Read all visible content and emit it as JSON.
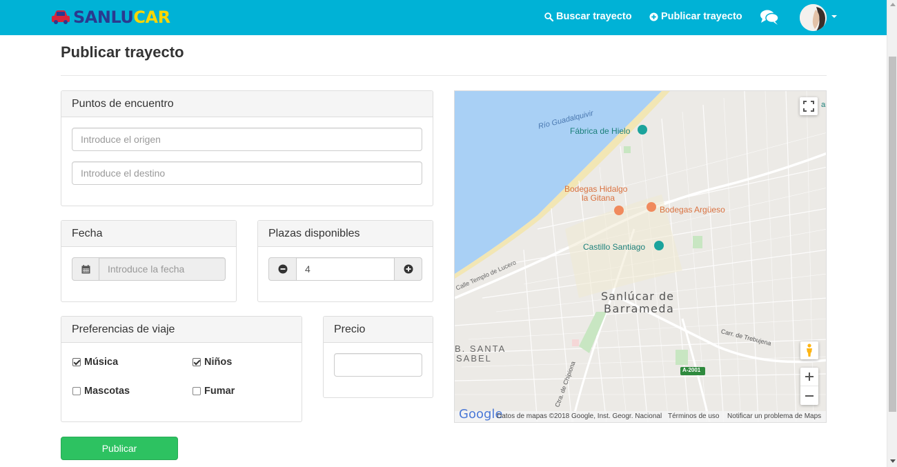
{
  "brand": {
    "part1": "SANLU",
    "part2": "CAR",
    "colors": {
      "navy": "#2a3a8f",
      "yellow": "#ffd600",
      "red": "#d8243a"
    }
  },
  "nav": {
    "search_label": "Buscar trayecto",
    "publish_label": "Publicar trayecto",
    "icons": [
      "search-icon",
      "plus-circle-icon",
      "chat-icon",
      "avatar",
      "caret-down-icon"
    ],
    "background": "#00b2d6"
  },
  "page": {
    "title": "Publicar trayecto"
  },
  "meeting_points": {
    "heading": "Puntos de encuentro",
    "origin": {
      "value": "",
      "placeholder": "Introduce el origen"
    },
    "destination": {
      "value": "",
      "placeholder": "Introduce el destino"
    }
  },
  "date": {
    "heading": "Fecha",
    "value": "",
    "placeholder": "Introduce la fecha",
    "icon": "calendar-icon"
  },
  "seats": {
    "heading": "Plazas disponibles",
    "value": "4",
    "icons": [
      "minus-circle-icon",
      "plus-circle-icon"
    ]
  },
  "preferences": {
    "heading": "Preferencias de viaje",
    "items": [
      {
        "label": "Música",
        "checked": true
      },
      {
        "label": "Niños",
        "checked": true
      },
      {
        "label": "Mascotas",
        "checked": false
      },
      {
        "label": "Fumar",
        "checked": false
      }
    ]
  },
  "price": {
    "heading": "Precio",
    "value": ""
  },
  "publish_button": {
    "label": "Publicar",
    "color": "#2dc261"
  },
  "map": {
    "labels": {
      "river": "Río Guadalquivir",
      "fabrica": "Fábrica de Hielo",
      "bodegas_hidalgo_1": "Bodegas Hidalgo",
      "bodegas_hidalgo_2": "la Gitana",
      "bodegas_argueso": "Bodegas Argüeso",
      "castillo": "Castillo Santiago",
      "calle_templo": "Calle Templo de Lucero",
      "city_1": "Sanlúcar de",
      "city_2": "Barrameda",
      "santa_1": "B. SANTA",
      "santa_2": "SABEL",
      "trebujena": "Carr. de Trebujena",
      "chipiona": "Ctra. de Chipiona",
      "road_shield": "A-2001",
      "edge_fragment": "anl"
    },
    "footer": {
      "google": "Google",
      "data": "Datos de mapas ©2018 Google, Inst. Geogr. Nacional",
      "terms": "Términos de uso",
      "report": "Notificar un problema de Maps"
    },
    "colors": {
      "water": "#a9d0f5",
      "land": "#eceae6",
      "park": "#c8e6c2",
      "poi_food": "#f08a5d",
      "poi_teal": "#1ba39c"
    }
  }
}
